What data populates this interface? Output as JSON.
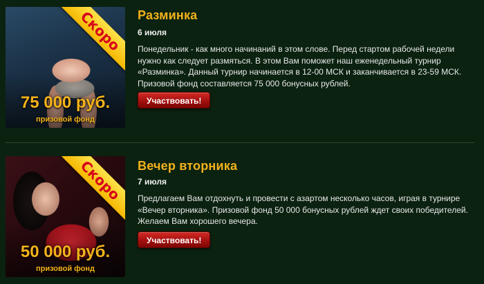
{
  "tournaments": [
    {
      "ribbon": "Скоро",
      "prize_amount": "75 000 руб.",
      "prize_label": "призовой фонд",
      "title": "Разминка",
      "date": "6 июля",
      "description": "Понедельник - как много начинаний в этом слове. Перед стартом рабочей недели нужно как следует размяться. В этом Вам поможет наш еженедельный турнир «Разминка». Данный турнир начинается в 12-00 МСК и заканчивается в 23-59 МСК. Призовой фонд составляется 75 000 бонусных рублей.",
      "button_label": "Участвовать!"
    },
    {
      "ribbon": "Скоро",
      "prize_amount": "50 000 руб.",
      "prize_label": "призовой фонд",
      "title": "Вечер вторника",
      "date": "7 июля",
      "description": "Предлагаем Вам отдохнуть и провести с азартом несколько часов, играя в турнире «Вечер вторника». Призовой фонд 50 000 бонусных рублей ждет своих победителей. Желаем Вам хорошего вечера.",
      "button_label": "Участвовать!"
    }
  ],
  "colors": {
    "background": "#0b2210",
    "title": "#f3b21c",
    "ribbon": "#ffd21f",
    "ribbon_text": "#d6001a",
    "button": "#b3140f"
  }
}
